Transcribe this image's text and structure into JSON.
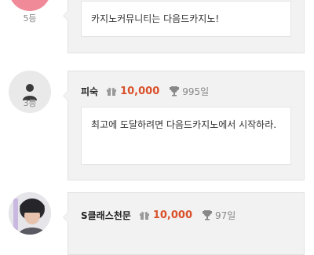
{
  "posts": [
    {
      "rank": "5등",
      "message": "카지노커뮤니티는 다음드카지노!"
    },
    {
      "rank": "3등",
      "name": "피숙",
      "points": "10,000",
      "days": "995일",
      "message": "최고에 도달하려면 다음드카지노에서 시작하라."
    },
    {
      "name": "S클래스천문",
      "points": "10,000",
      "days": "97일"
    }
  ],
  "colors": {
    "accent": "#d9512a",
    "card_bg": "#f2f2f2",
    "avatar_bg": "#e9e9e9",
    "avatar_pink": "#f08a98"
  },
  "icons": [
    "user-icon",
    "gift-icon",
    "trophy-icon"
  ]
}
